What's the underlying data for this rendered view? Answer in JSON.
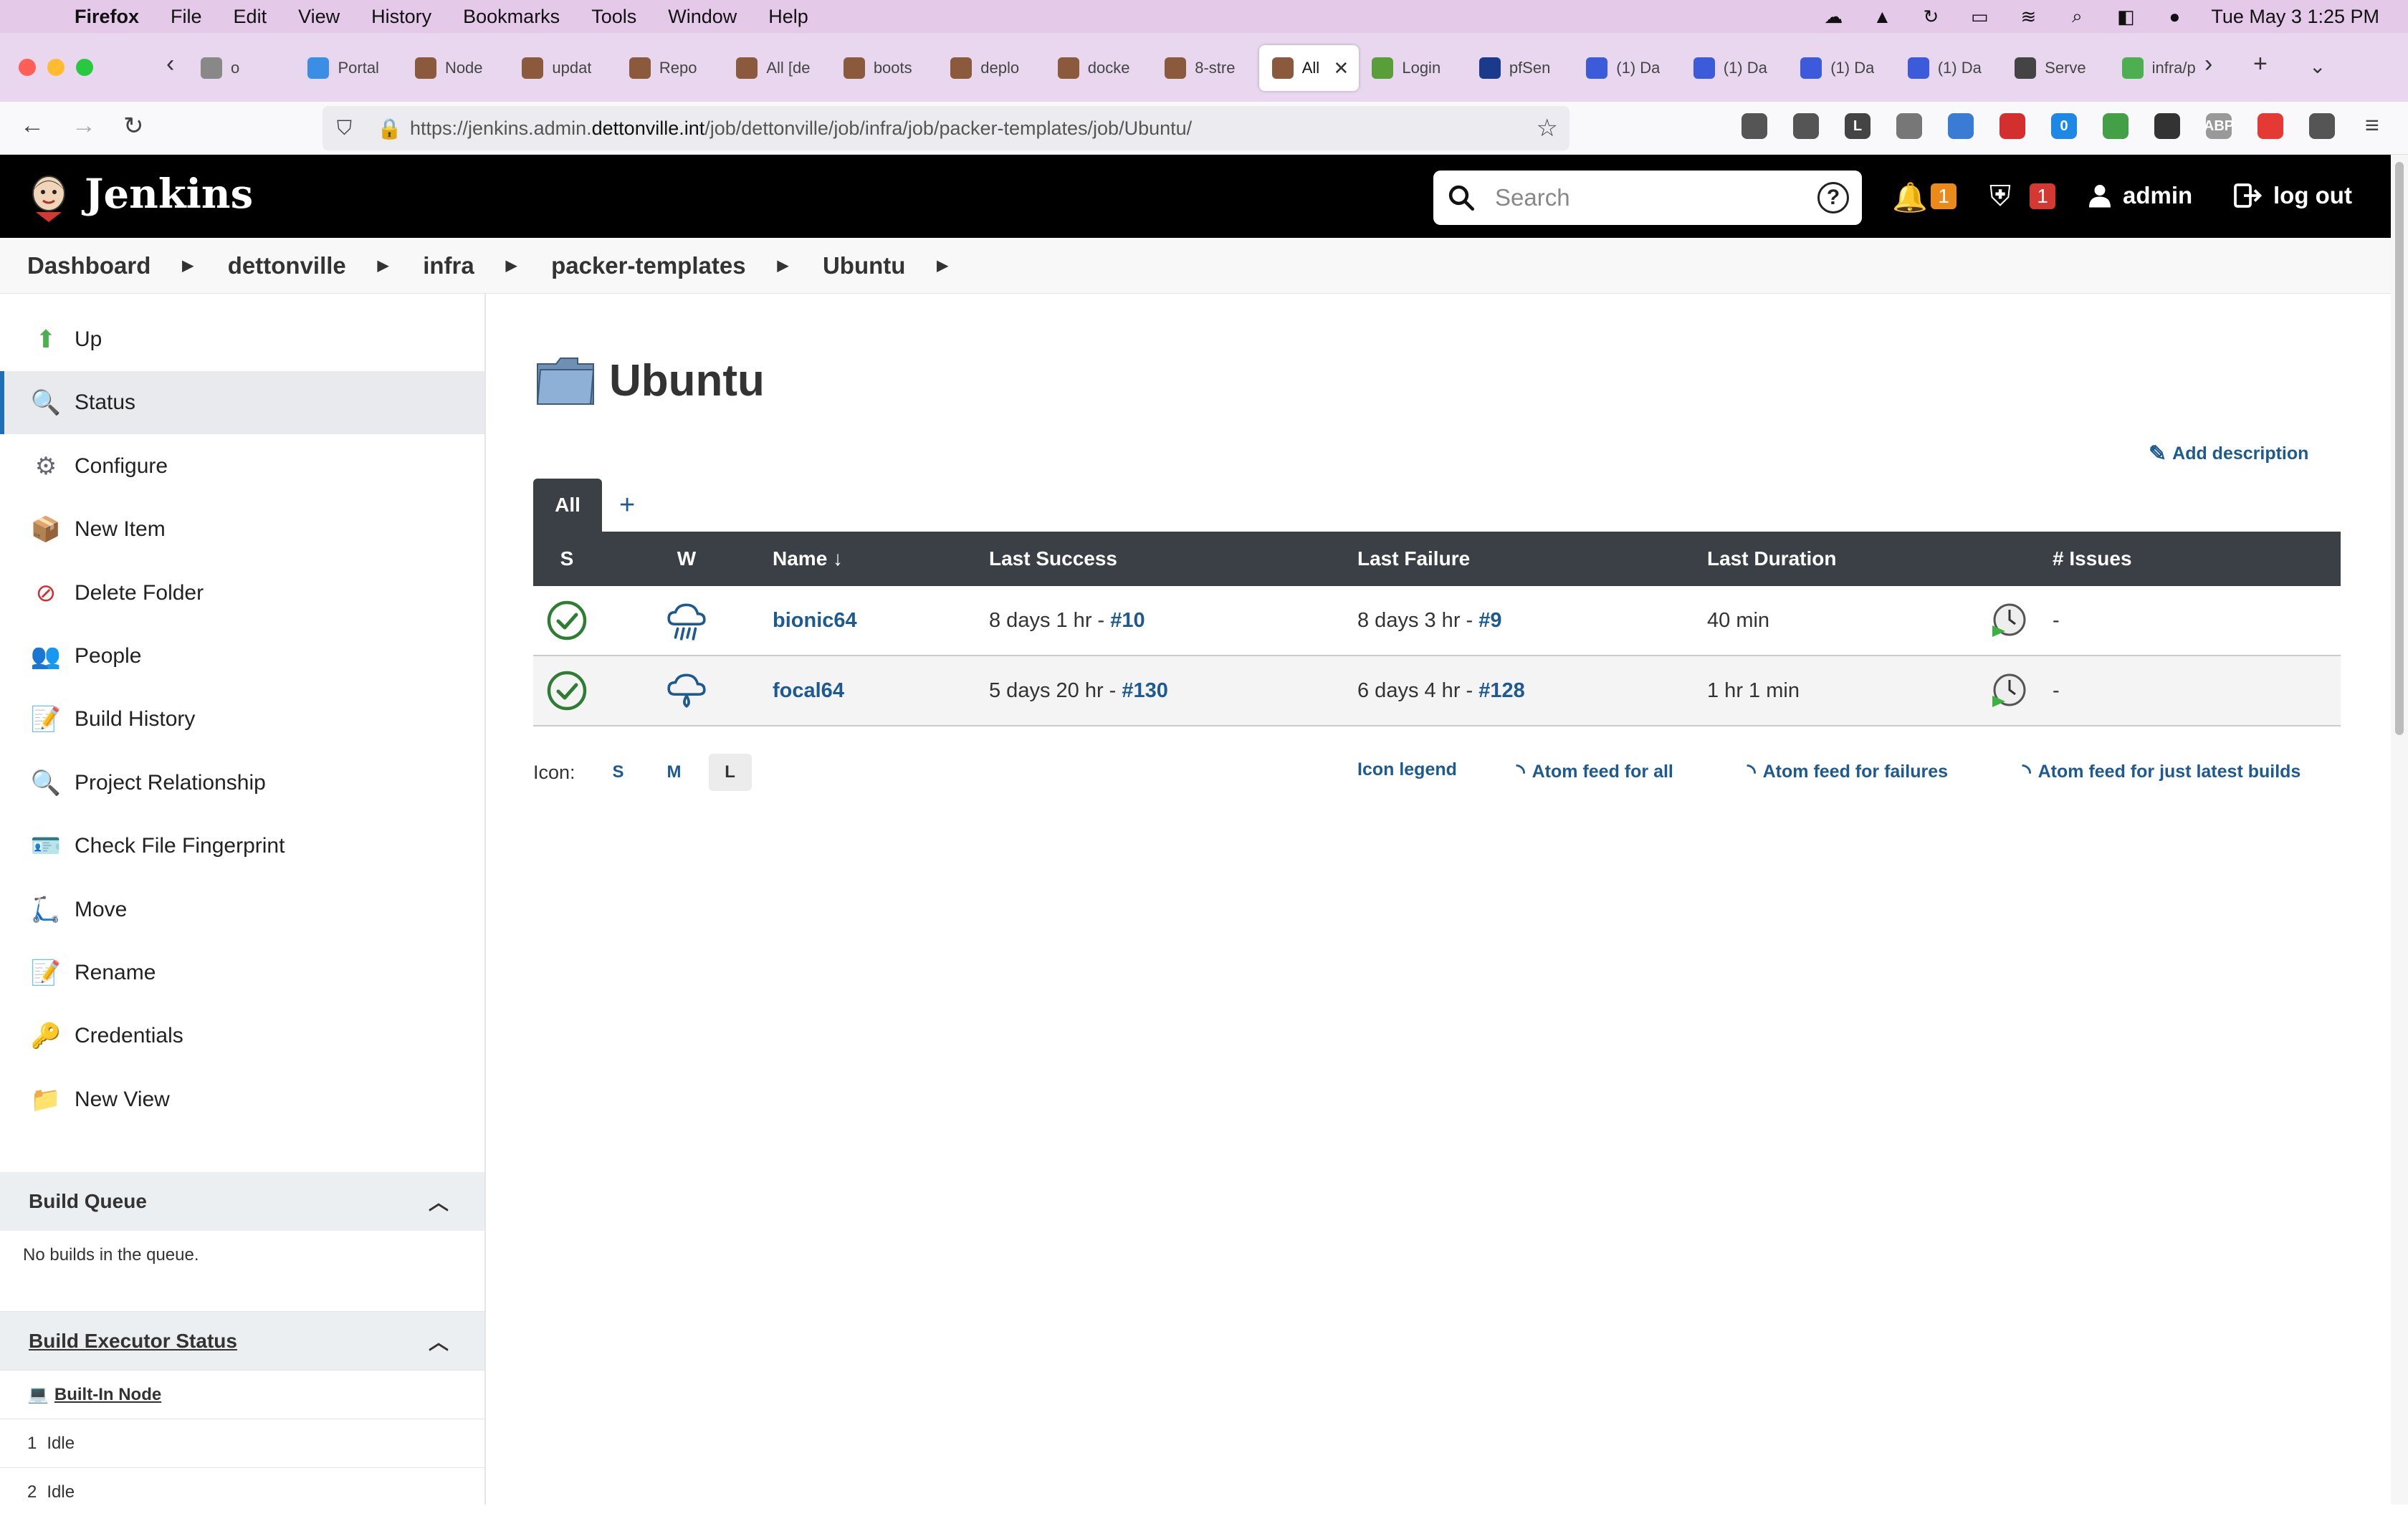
{
  "menubar": {
    "app": "Firefox",
    "items": [
      "File",
      "Edit",
      "View",
      "History",
      "Bookmarks",
      "Tools",
      "Window",
      "Help"
    ],
    "clock": "Tue May 3  1:25 PM"
  },
  "tabs": [
    {
      "label": "o",
      "color": "#888"
    },
    {
      "label": "Portal",
      "color": "#3a8ee6"
    },
    {
      "label": "Node",
      "color": "#8b5a3c"
    },
    {
      "label": "updat",
      "color": "#8b5a3c"
    },
    {
      "label": "Repo",
      "color": "#8b5a3c"
    },
    {
      "label": "All [de",
      "color": "#8b5a3c"
    },
    {
      "label": "boots",
      "color": "#8b5a3c"
    },
    {
      "label": "deplo",
      "color": "#8b5a3c"
    },
    {
      "label": "docke",
      "color": "#8b5a3c"
    },
    {
      "label": "8-stre",
      "color": "#8b5a3c"
    },
    {
      "label": "All",
      "color": "#8b5a3c",
      "active": true
    },
    {
      "label": "Login",
      "color": "#5a9e3a"
    },
    {
      "label": "pfSen",
      "color": "#1a3a8b"
    },
    {
      "label": "(1) Da",
      "color": "#3b5bdb"
    },
    {
      "label": "(1) Da",
      "color": "#3b5bdb"
    },
    {
      "label": "(1) Da",
      "color": "#3b5bdb"
    },
    {
      "label": "(1) Da",
      "color": "#3b5bdb"
    },
    {
      "label": "Serve",
      "color": "#444"
    },
    {
      "label": "infra/p",
      "color": "#4caf50"
    }
  ],
  "url": {
    "prefix": "https://jenkins.admin.",
    "domain": "dettonville.int",
    "path": "/job/dettonville/job/infra/job/packer-templates/job/Ubuntu/"
  },
  "extensions": [
    {
      "label": "",
      "color": "#555"
    },
    {
      "label": "",
      "color": "#555"
    },
    {
      "label": "L",
      "color": "#444"
    },
    {
      "label": "",
      "color": "#777"
    },
    {
      "label": "",
      "color": "#3a7bd5"
    },
    {
      "label": "",
      "color": "#d32f2f"
    },
    {
      "label": "0",
      "color": "#1e88e5"
    },
    {
      "label": "",
      "color": "#43a047"
    },
    {
      "label": "",
      "color": "#333"
    },
    {
      "label": "ABP",
      "color": "#999"
    },
    {
      "label": "",
      "color": "#e53935"
    },
    {
      "label": "",
      "color": "#555"
    }
  ],
  "header": {
    "title": "Jenkins",
    "search_placeholder": "Search",
    "help": "?",
    "notifications_count": "1",
    "security_count": "1",
    "user": "admin",
    "logout": "log out"
  },
  "breadcrumb": [
    "Dashboard",
    "dettonville",
    "infra",
    "packer-templates",
    "Ubuntu"
  ],
  "sidebar": {
    "items": [
      {
        "label": "Up",
        "icon": "up-arrow-icon",
        "glyph": "⬆",
        "color": "#4caf50"
      },
      {
        "label": "Status",
        "icon": "magnifier-icon",
        "glyph": "🔍",
        "color": "#555",
        "active": true
      },
      {
        "label": "Configure",
        "icon": "gear-icon",
        "glyph": "⚙",
        "color": "#667"
      },
      {
        "label": "New Item",
        "icon": "package-icon",
        "glyph": "📦",
        "color": "#c8963c"
      },
      {
        "label": "Delete Folder",
        "icon": "no-entry-icon",
        "glyph": "⊘",
        "color": "#d32f2f"
      },
      {
        "label": "People",
        "icon": "people-icon",
        "glyph": "👥",
        "color": "#8b5a3c"
      },
      {
        "label": "Build History",
        "icon": "notepad-icon",
        "glyph": "📝",
        "color": "#777"
      },
      {
        "label": "Project Relationship",
        "icon": "magnifier-icon",
        "glyph": "🔍",
        "color": "#555"
      },
      {
        "label": "Check File Fingerprint",
        "icon": "fingerprint-card-icon",
        "glyph": "🪪",
        "color": "#777"
      },
      {
        "label": "Move",
        "icon": "move-icon",
        "glyph": "🛴",
        "color": "#777"
      },
      {
        "label": "Rename",
        "icon": "notepad-icon",
        "glyph": "📝",
        "color": "#777"
      },
      {
        "label": "Credentials",
        "icon": "keys-icon",
        "glyph": "🔑",
        "color": "#b8860b"
      },
      {
        "label": "New View",
        "icon": "folder-icon",
        "glyph": "📁",
        "color": "#4a78b8"
      }
    ],
    "build_queue": {
      "title": "Build Queue",
      "empty": "No builds in the queue."
    },
    "executor": {
      "title": "Build Executor Status",
      "node": "Built-In Node",
      "rows": [
        {
          "num": "1",
          "status": "Idle"
        },
        {
          "num": "2",
          "status": "Idle"
        }
      ]
    }
  },
  "main": {
    "title": "Ubuntu",
    "add_description": "Add description",
    "view_tab": "All",
    "add_view": "+",
    "columns": [
      "S",
      "W",
      "Name ↓",
      "Last Success",
      "Last Failure",
      "Last Duration",
      "",
      "# Issues"
    ],
    "jobs": [
      {
        "name": "bionic64",
        "last_success": "8 days 1 hr - ",
        "last_success_build": "#10",
        "last_failure": "8 days 3 hr - ",
        "last_failure_build": "#9",
        "duration": "40 min",
        "issues": "-",
        "weather": "rain"
      },
      {
        "name": "focal64",
        "last_success": "5 days 20 hr - ",
        "last_success_build": "#130",
        "last_failure": "6 days 4 hr - ",
        "last_failure_build": "#128",
        "duration": "1 hr 1 min",
        "issues": "-",
        "weather": "drizzle"
      }
    ],
    "icon_label": "Icon:",
    "icon_sizes": [
      "S",
      "M",
      "L"
    ],
    "icon_selected": "L",
    "footer_links": {
      "legend": "Icon legend",
      "feed_all": "Atom feed for all",
      "feed_failures": "Atom feed for failures",
      "feed_latest": "Atom feed for just latest builds"
    }
  }
}
